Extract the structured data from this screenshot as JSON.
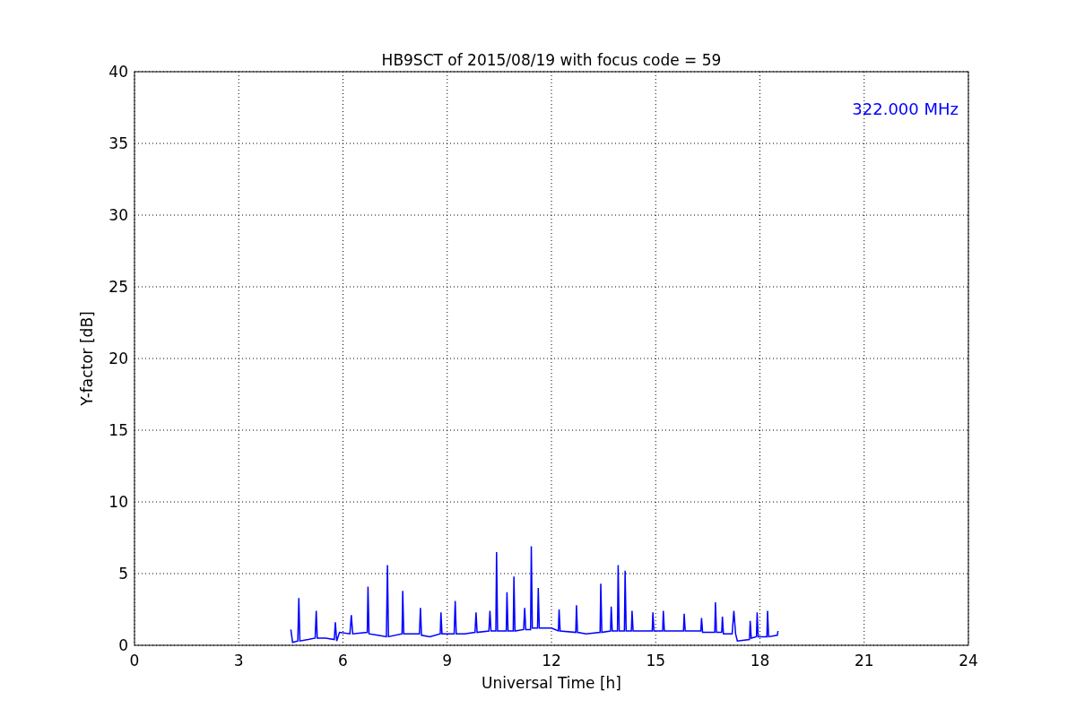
{
  "chart": {
    "chart_data": {
      "type": "line",
      "title": "HB9SCT of 2015/08/19 with focus code = 59",
      "xlabel": "Universal Time [h]",
      "ylabel": "Y-factor [dB]",
      "x": [
        4.5,
        4.55,
        4.7,
        4.73,
        4.76,
        5.0,
        5.2,
        5.23,
        5.26,
        5.5,
        5.75,
        5.78,
        5.82,
        5.9,
        6.2,
        6.24,
        6.28,
        6.7,
        6.72,
        6.75,
        7.0,
        7.25,
        7.28,
        7.31,
        7.7,
        7.72,
        7.75,
        8.2,
        8.23,
        8.26,
        8.5,
        8.8,
        8.82,
        8.85,
        9.2,
        9.23,
        9.26,
        9.5,
        9.8,
        9.83,
        9.86,
        10.2,
        10.23,
        10.26,
        10.4,
        10.42,
        10.45,
        10.7,
        10.72,
        10.75,
        10.9,
        10.92,
        10.95,
        11.2,
        11.23,
        11.26,
        11.4,
        11.42,
        11.45,
        11.6,
        11.62,
        11.65,
        12.0,
        12.2,
        12.22,
        12.25,
        12.7,
        12.72,
        12.75,
        13.0,
        13.4,
        13.42,
        13.45,
        13.7,
        13.72,
        13.75,
        13.9,
        13.92,
        13.95,
        14.1,
        14.12,
        14.15,
        14.3,
        14.32,
        14.35,
        14.9,
        14.92,
        14.95,
        15.2,
        15.22,
        15.25,
        15.8,
        15.82,
        15.85,
        16.3,
        16.32,
        16.35,
        16.7,
        16.72,
        16.75,
        16.9,
        16.92,
        16.95,
        17.2,
        17.25,
        17.3,
        17.35,
        17.7,
        17.72,
        17.75,
        17.9,
        17.92,
        17.95,
        18.2,
        18.22,
        18.25,
        18.5,
        18.52
      ],
      "series": [
        {
          "name": "322.000 MHz",
          "color": "#0000ff",
          "values": [
            1.1,
            0.2,
            0.3,
            3.3,
            0.3,
            0.4,
            0.5,
            2.4,
            0.5,
            0.5,
            0.4,
            1.6,
            0.3,
            0.9,
            0.8,
            2.1,
            0.8,
            0.9,
            4.1,
            0.8,
            0.7,
            0.6,
            5.6,
            0.6,
            0.8,
            3.8,
            0.8,
            0.8,
            2.6,
            0.7,
            0.6,
            0.8,
            2.3,
            0.8,
            0.8,
            3.1,
            0.8,
            0.8,
            0.9,
            2.3,
            0.9,
            1.0,
            2.4,
            1.0,
            1.0,
            6.5,
            1.0,
            1.0,
            3.7,
            1.0,
            1.0,
            4.8,
            1.0,
            1.1,
            2.6,
            1.1,
            1.1,
            6.9,
            1.2,
            1.2,
            4.0,
            1.2,
            1.2,
            1.0,
            2.5,
            1.0,
            0.9,
            2.8,
            0.9,
            0.8,
            0.9,
            4.3,
            0.9,
            1.0,
            2.7,
            1.0,
            1.0,
            5.6,
            1.0,
            1.0,
            5.2,
            1.0,
            1.0,
            2.4,
            1.0,
            1.0,
            2.3,
            1.0,
            1.0,
            2.4,
            1.0,
            1.0,
            2.2,
            1.0,
            1.0,
            1.9,
            0.9,
            0.9,
            3.0,
            0.9,
            0.9,
            2.0,
            0.8,
            0.8,
            2.4,
            0.8,
            0.3,
            0.4,
            1.7,
            0.5,
            0.6,
            2.3,
            0.6,
            0.6,
            2.4,
            0.6,
            0.7,
            1.0
          ]
        }
      ],
      "xlim": [
        0,
        24
      ],
      "ylim": [
        0,
        40
      ],
      "xticks": [
        0,
        3,
        6,
        9,
        12,
        15,
        18,
        21,
        24
      ],
      "yticks": [
        0,
        5,
        10,
        15,
        20,
        25,
        30,
        35,
        40
      ],
      "grid": true
    }
  }
}
